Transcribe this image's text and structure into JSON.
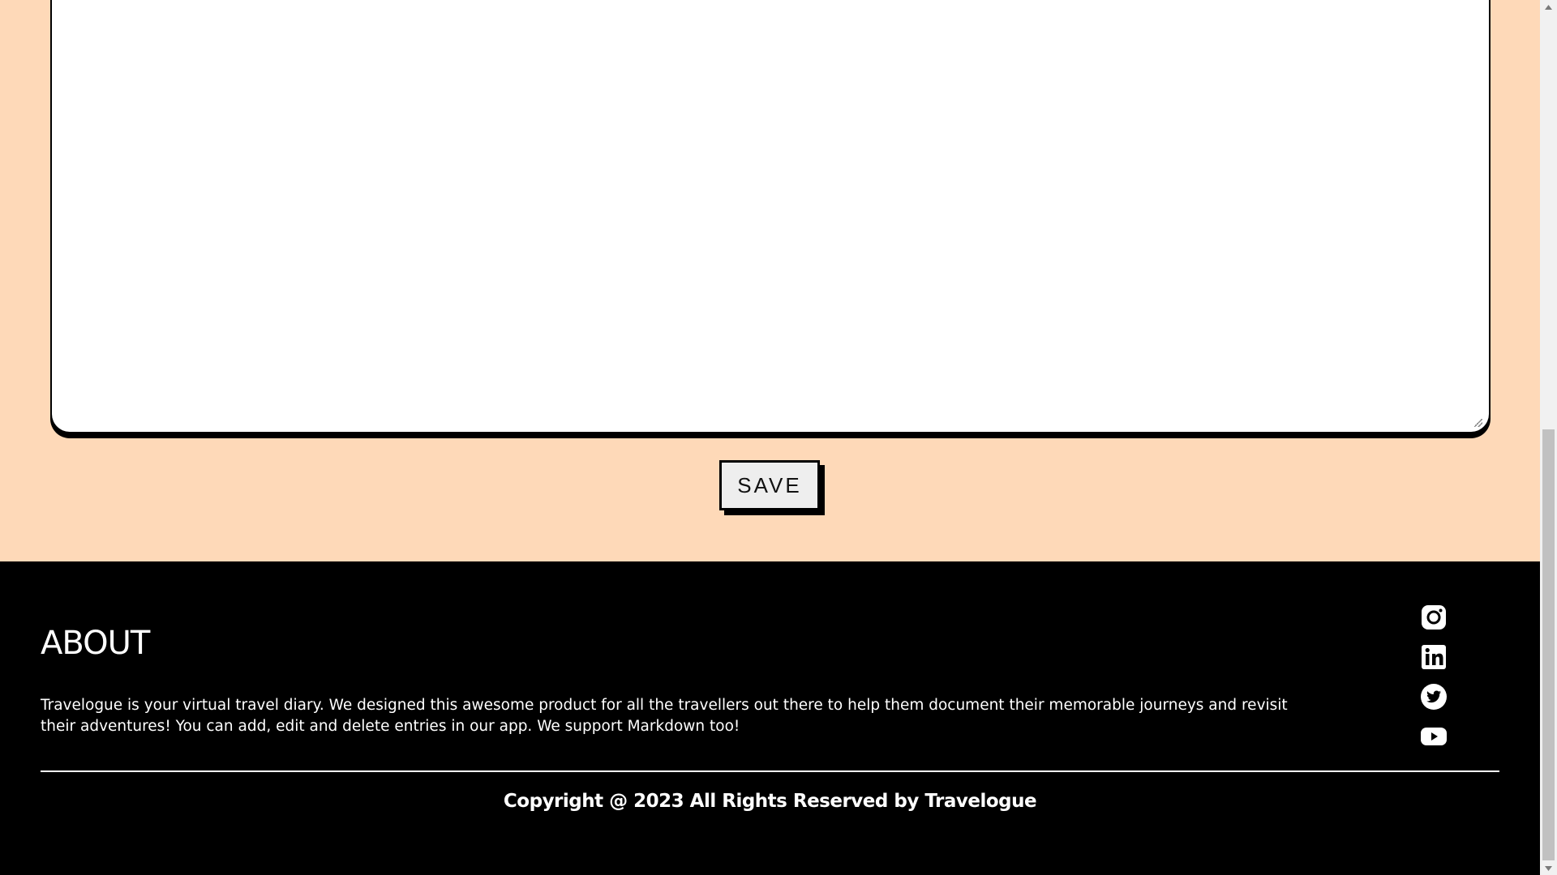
{
  "editor": {
    "content": ""
  },
  "actions": {
    "save_label": "SAVE"
  },
  "footer": {
    "about_title": "ABOUT",
    "about_text": "Travelogue is your virtual travel diary. We designed this awesome product for all the travellers out there to help them document their memorable journeys and revisit their adventures! You can add, edit and delete entries in our app. We support Markdown too!",
    "social_links": [
      {
        "icon": "instagram-icon"
      },
      {
        "icon": "linkedin-icon"
      },
      {
        "icon": "twitter-icon"
      },
      {
        "icon": "youtube-icon"
      }
    ],
    "copyright": "Copyright @ 2023 All Rights Reserved by Travelogue"
  },
  "colors": {
    "page_background": "#fed9b8",
    "footer_background": "#000000",
    "footer_text": "#ffffff",
    "button_background": "#eeeeee"
  }
}
